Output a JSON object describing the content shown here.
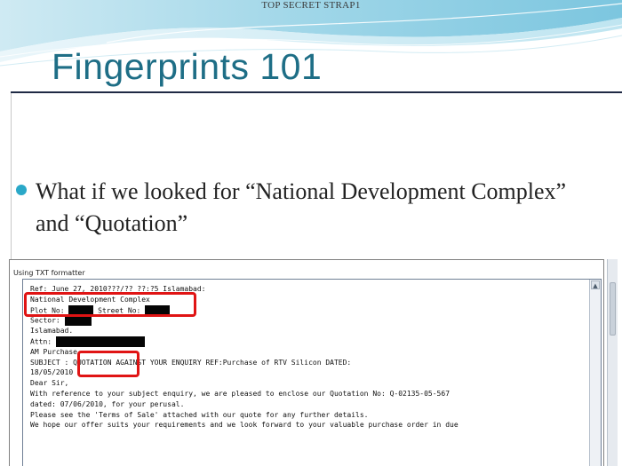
{
  "slide": {
    "classification": "TOP SECRET STRAP1",
    "title": "Fingerprints 101",
    "bullet": "What if we looked for “National Development Complex” and “Quotation”"
  },
  "screenshot": {
    "caption": "Using TXT formatter",
    "lines": [
      {
        "text": "Ref: June 27, 2010???/?? ??:?5 Islamabad:"
      },
      {
        "text": "National Development Complex"
      },
      {
        "prefix": "Plot No: ",
        "mid": " Street No: ",
        "redact1": 28,
        "redact2": 28
      },
      {
        "prefix": "Sector: ",
        "redact1": 30
      },
      {
        "text": "Islamabad."
      },
      {
        "prefix": "Attn: ",
        "redact1": 100
      },
      {
        "text": "AM Purchase"
      },
      {
        "text": "SUBJECT : QUOTATION AGAINST YOUR ENQUIRY REF:Purchase of RTV Silicon DATED:"
      },
      {
        "text": "18/05/2010"
      },
      {
        "text": "Dear Sir,"
      },
      {
        "text": "With reference to your subject enquiry, we are pleased to enclose our Quotation No: Q-02135-05-567"
      },
      {
        "text": "dated: 07/06/2010, for your perusal."
      },
      {
        "text": "Please see the 'Terms of Sale' attached with our quote for any further details."
      },
      {
        "text": "We hope our offer suits your requirements and we look forward to your valuable purchase order in due"
      }
    ]
  },
  "colors": {
    "title": "#1e6e86",
    "highlight": "#e01414",
    "bullet": "#2aa8c8"
  }
}
